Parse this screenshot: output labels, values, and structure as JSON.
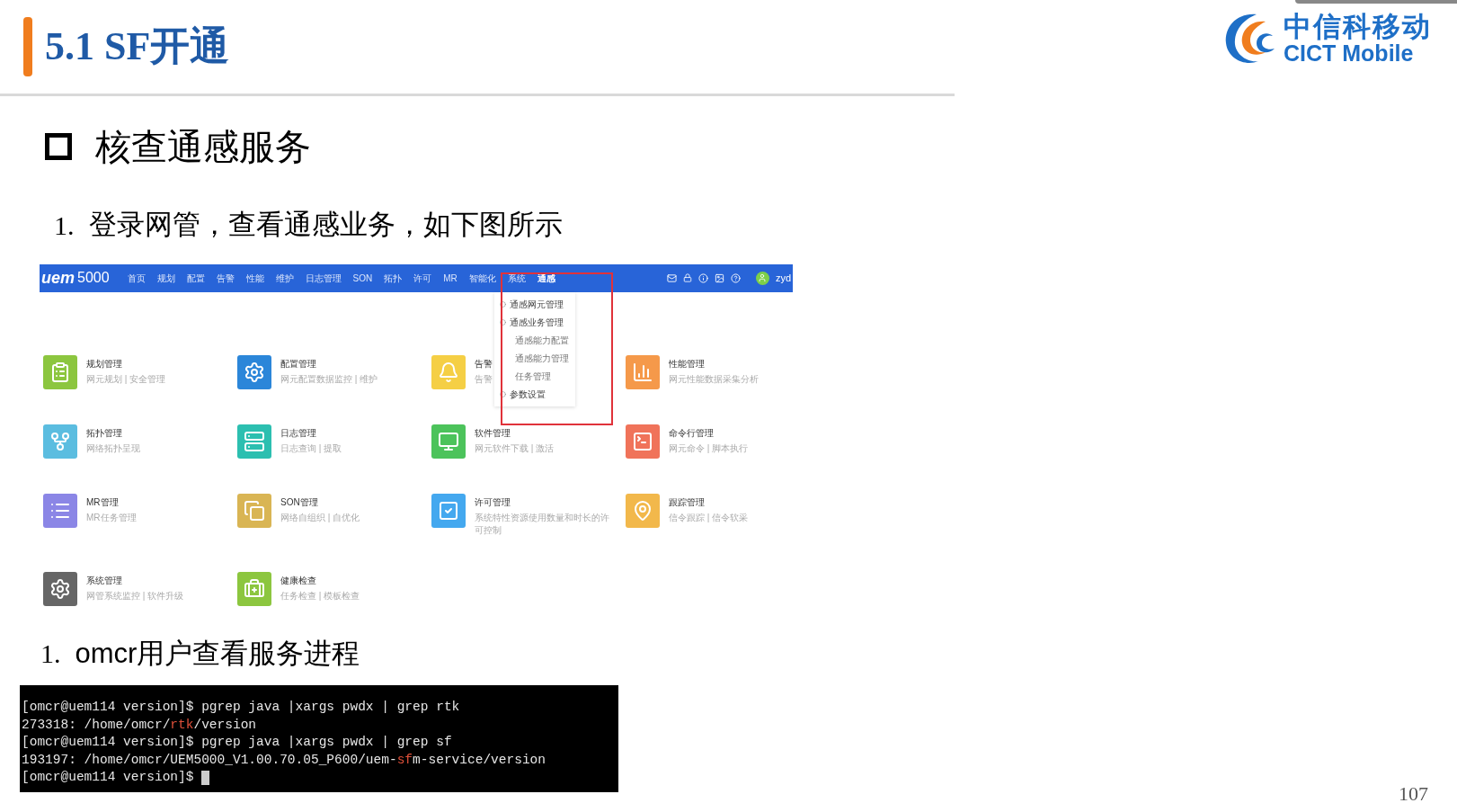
{
  "slide": {
    "title": "5.1 SF开通",
    "logo": {
      "name_cn": "中信科移动",
      "name_en": "CICT Mobile"
    },
    "section": "核查通感服务",
    "page_number": "107"
  },
  "steps": [
    {
      "number": "1.",
      "text": "登录网管，查看通感业务，如下图所示"
    },
    {
      "number": "1.",
      "text": "omcr用户查看服务进程"
    }
  ],
  "uem": {
    "brand": "uem",
    "version": "5000",
    "user": "zyd",
    "nav": [
      {
        "label": "首页",
        "selected": false
      },
      {
        "label": "规划",
        "selected": false
      },
      {
        "label": "配置",
        "selected": false
      },
      {
        "label": "告警",
        "selected": false
      },
      {
        "label": "性能",
        "selected": false
      },
      {
        "label": "维护",
        "selected": false
      },
      {
        "label": "日志管理",
        "selected": false
      },
      {
        "label": "SON",
        "selected": false
      },
      {
        "label": "拓扑",
        "selected": false
      },
      {
        "label": "许可",
        "selected": false
      },
      {
        "label": "MR",
        "selected": false
      },
      {
        "label": "智能化",
        "selected": false
      },
      {
        "label": "系统",
        "selected": false
      },
      {
        "label": "通感",
        "selected": true
      }
    ],
    "modules": [
      {
        "title": "规划管理",
        "desc": "网元规划 | 安全管理",
        "color": "#8cc63f"
      },
      {
        "title": "配置管理",
        "desc": "网元配置数据监控 | 维护",
        "color": "#2b86d9"
      },
      {
        "title": "告警",
        "desc": "告警",
        "color": "#f5cf45"
      },
      {
        "title": "性能管理",
        "desc": "网元性能数据采集分析",
        "color": "#f5994a"
      },
      {
        "title": "拓扑管理",
        "desc": "网络拓扑呈现",
        "color": "#5bbde0"
      },
      {
        "title": "日志管理",
        "desc": "日志查询 | 提取",
        "color": "#2cbfb0"
      },
      {
        "title": "软件管理",
        "desc": "网元软件下载 | 激活",
        "color": "#4cc35b"
      },
      {
        "title": "命令行管理",
        "desc": "网元命令 | 脚本执行",
        "color": "#f0735a"
      },
      {
        "title": "MR管理",
        "desc": "MR任务管理",
        "color": "#8b86e6"
      },
      {
        "title": "SON管理",
        "desc": "网络自组织 | 自优化",
        "color": "#d9b554"
      },
      {
        "title": "许可管理",
        "desc": "系统特性资源使用数量和时长的许可控制",
        "color": "#44a8ef"
      },
      {
        "title": "跟踪管理",
        "desc": "信令跟踪 | 信令软采",
        "color": "#f2b84b"
      },
      {
        "title": "系统管理",
        "desc": "网管系统监控 | 软件升级",
        "color": "#666666"
      },
      {
        "title": "健康检查",
        "desc": "任务检查 | 模板检查",
        "color": "#8cc63f"
      }
    ],
    "dropdown": [
      {
        "label": "通感网元管理",
        "kind": "group"
      },
      {
        "label": "通感业务管理",
        "kind": "group"
      },
      {
        "label": "通感能力配置",
        "kind": "sub"
      },
      {
        "label": "通感能力管理",
        "kind": "sub"
      },
      {
        "label": "任务管理",
        "kind": "sub"
      },
      {
        "label": "参数设置",
        "kind": "group"
      }
    ]
  },
  "terminal": {
    "lines": [
      {
        "segments": [
          {
            "text": "[omcr@uem114 version]$ pgrep java |xargs pwdx | grep rtk",
            "highlight": false
          }
        ]
      },
      {
        "segments": [
          {
            "text": "273318: /home/omcr/",
            "highlight": false
          },
          {
            "text": "rtk",
            "highlight": true
          },
          {
            "text": "/version",
            "highlight": false
          }
        ]
      },
      {
        "segments": [
          {
            "text": "[omcr@uem114 version]$ pgrep java |xargs pwdx | grep sf",
            "highlight": false
          }
        ]
      },
      {
        "segments": [
          {
            "text": "193197: /home/omcr/UEM5000_V1.00.70.05_P600/uem-",
            "highlight": false
          },
          {
            "text": "sf",
            "highlight": true
          },
          {
            "text": "m-service/version",
            "highlight": false
          }
        ]
      },
      {
        "segments": [
          {
            "text": "[omcr@uem114 version]$ ",
            "highlight": false
          }
        ],
        "cursor": true
      }
    ]
  }
}
